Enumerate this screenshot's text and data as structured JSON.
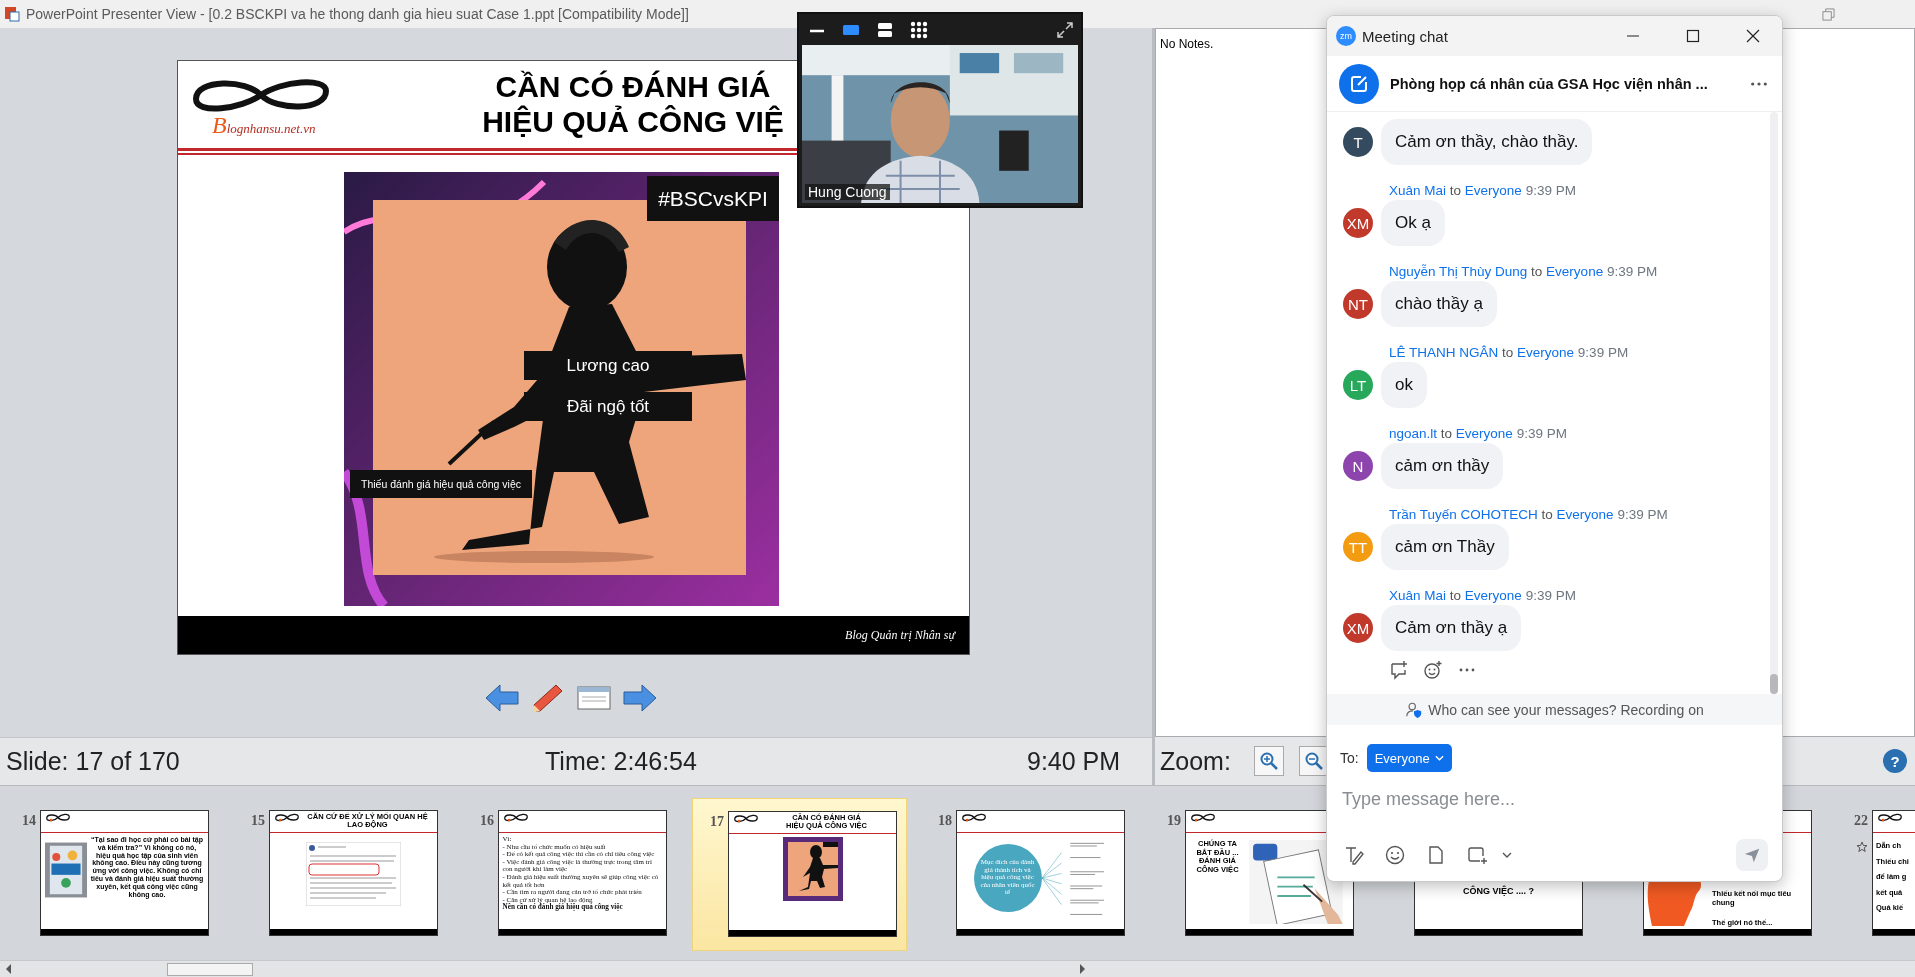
{
  "window": {
    "title": "PowerPoint Presenter View - [0.2 BSCKPI va he thong danh gia hieu suat Case 1.ppt [Compatibility Mode]]"
  },
  "slide": {
    "logo_text": "Blognhansu.net.vn",
    "title_lines": [
      "CẦN CÓ ĐÁNH GIÁ",
      "HIỆU QUẢ CÔNG VIỆ"
    ],
    "hashtag": "#BSCvsKPI",
    "labels": [
      "Lương cao",
      "Đãi ngộ tốt"
    ],
    "caption": "Thiếu đánh giá hiệu quả công việc",
    "footer": "Blog Quản trị Nhân sự"
  },
  "status_bar": {
    "slide": "Slide: 17 of 170",
    "time": "Time: 2:46:54",
    "clock": "9:40 PM"
  },
  "notes": {
    "text": "No Notes.",
    "zoom_label": "Zoom:",
    "help": "?"
  },
  "video": {
    "name": "Hung Cuong",
    "layouts": [
      {
        "kind": "speaker",
        "selected": true
      },
      {
        "kind": "stacked",
        "selected": false
      },
      {
        "kind": "grid",
        "selected": false
      }
    ]
  },
  "chat": {
    "logo": "zm",
    "title": "Meeting chat",
    "room": "Phòng họp cá nhân của GSA Học viện nhân ...",
    "messages": [
      {
        "initials": "T",
        "color": "#344a5e",
        "text": "Cảm ơn thầy, chào thầy."
      },
      {
        "initials": "XM",
        "color": "#c0392b",
        "sender": "Xuân Mai",
        "to": "to",
        "audience": "Everyone",
        "time": "9:39 PM",
        "text": "Ok ạ"
      },
      {
        "initials": "NT",
        "color": "#c0392b",
        "sender": "Nguyễn Thị Thùy Dung",
        "to": "to",
        "audience": "Everyone",
        "time": "9:39 PM",
        "text": "chào thầy ạ"
      },
      {
        "initials": "LT",
        "color": "#27a85a",
        "sender": "LÊ THANH NGÂN",
        "to": "to",
        "audience": "Everyone",
        "time": "9:39 PM",
        "text": "ok"
      },
      {
        "initials": "N",
        "color": "#8e44ad",
        "sender": "ngoan.lt",
        "to": "to",
        "audience": "Everyone",
        "time": "9:39 PM",
        "text": "cảm ơn thầy"
      },
      {
        "initials": "TT",
        "color": "#f39c12",
        "sender": "Trần Tuyến COHOTECH",
        "to": "to",
        "audience": "Everyone",
        "time": "9:39 PM",
        "text": "cảm ơn Thầy"
      },
      {
        "initials": "XM",
        "color": "#c0392b",
        "sender": "Xuân Mai",
        "to": "to",
        "audience": "Everyone",
        "time": "9:39 PM",
        "text": "Cảm ơn thầy ạ"
      }
    ],
    "privacy": "Who can see your messages? Recording on",
    "to_label": "To:",
    "recipient": "Everyone",
    "placeholder": "Type message here..."
  },
  "thumbnails": [
    {
      "number": "14",
      "selected": false,
      "animated": false,
      "kind": "quote",
      "text": "“Tại sao đi học cứ phải có bài tập và kiểm tra?” Vì không có nó, hiệu quả học tập của sinh viên không cao. Điều này cũng tương ứng với công việc. Không có chỉ tiêu và đánh giá hiệu suất thường xuyên, kết quả công việc cũng không cao."
    },
    {
      "number": "15",
      "selected": false,
      "animated": false,
      "kind": "screenshot",
      "title_lines": [
        "CĂN CỨ ĐỂ XỬ LÝ MỐI QUAN HỆ",
        "LAO ĐỘNG"
      ]
    },
    {
      "number": "16",
      "selected": false,
      "animated": false,
      "kind": "bullets",
      "heading": "Vì:",
      "items": [
        "- Nhu cầu tổ chức muốn có hiệu suất",
        "- Để có kết quả công việc thì cần có chỉ tiêu công việc",
        "- Việc đánh giá công việc là thường trực trong tâm trí con người khi làm việc",
        "- Đánh giá hiệu suất thường xuyên sẽ giúp công việc có kết quả tốt hơn",
        "- Cần tìm ra người đang cản trở tổ chức phát triển",
        "- Căn cứ xử lý quan hệ lao động"
      ],
      "conclusion": "Nên cần có đánh giá hiệu quả công việc"
    },
    {
      "number": "17",
      "selected": true,
      "animated": false,
      "title_lines": [
        "CẦN CÓ ĐÁNH GIÁ",
        "HIỆU QUẢ CÔNG VIỆC"
      ]
    },
    {
      "number": "18",
      "selected": false,
      "animated": false,
      "kind": "diagram",
      "text": "Mục đích của đánh giá thành tích và hiệu quả công việc của nhân viên quốc tế"
    },
    {
      "number": "19",
      "selected": false,
      "animated": false,
      "kind": "text-image",
      "text": "CHÚNG TA BẮT ĐẦU ... ĐÁNH GIÁ CÔNG VIỆC"
    },
    {
      "selected": false,
      "animated": false,
      "kind": "question",
      "text": "CÔNG VIỆC .... ?"
    },
    {
      "selected": false,
      "animated": false,
      "kind": "head",
      "lines": [
        "Thiếu kết nối mục tiêu chung",
        "Thế giới nó thế..."
      ]
    },
    {
      "number": "22",
      "selected": false,
      "animated": true,
      "kind": "edge",
      "lines": [
        "Dẫn ch",
        "Thiếu chi",
        "để làm g",
        "kết quả",
        "Quá kiế"
      ]
    }
  ]
}
